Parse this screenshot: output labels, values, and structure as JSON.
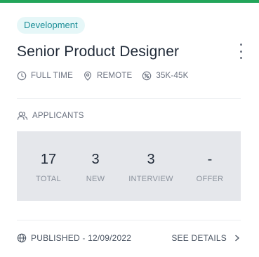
{
  "card": {
    "badge": "Development",
    "title": "Senior Product Designer",
    "meta": {
      "job_type": "FULL TIME",
      "location": "REMOTE",
      "salary": "35K-45K"
    },
    "applicants_label": "APPLICANTS",
    "stats": [
      {
        "value": "17",
        "label": "TOTAL"
      },
      {
        "value": "3",
        "label": "NEW"
      },
      {
        "value": "3",
        "label": "INTERVIEW"
      },
      {
        "value": "-",
        "label": "OFFER"
      }
    ],
    "footer": {
      "published": "PUBLISHED - 12/09/2022",
      "details_link": "SEE DETAILS"
    }
  },
  "colors": {
    "accent_top": "#22a55a",
    "badge_bg": "#e6f7f8",
    "badge_text": "#1d8f98",
    "stats_bg": "#e5e7eb"
  },
  "icons": [
    "clock-icon",
    "location-pin-icon",
    "money-icon",
    "users-icon",
    "globe-icon",
    "chevron-right-icon",
    "more-vertical-icon"
  ]
}
